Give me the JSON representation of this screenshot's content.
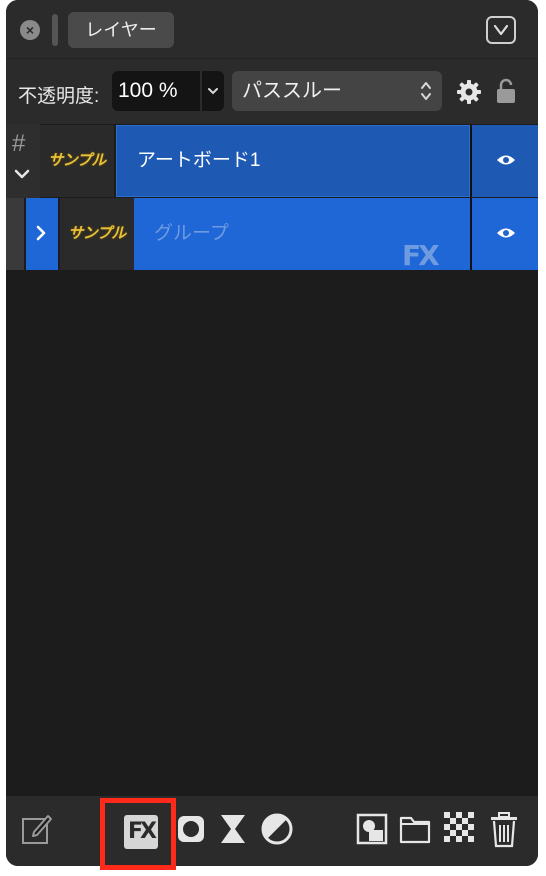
{
  "panel": {
    "tab_label": "レイヤー",
    "icons": {
      "close": "close-icon",
      "collapse": "chevron-down-icon"
    }
  },
  "options": {
    "opacity_label": "不透明度:",
    "opacity_value": "100 %",
    "blend_mode": "パススルー",
    "icons": {
      "settings": "gear-icon",
      "lock": "lock-icon"
    }
  },
  "layers": [
    {
      "name": "アートボード1",
      "thumbnail_text": "サンプル",
      "expanded": true,
      "selected": true,
      "visible": true
    },
    {
      "name": "グループ",
      "thumbnail_text": "サンプル",
      "expanded": false,
      "selected": true,
      "visible": true,
      "has_fx": true,
      "fx_label": "FX"
    }
  ],
  "toolbar": {
    "items": [
      "edit-icon",
      "fx-icon",
      "mask-icon",
      "adjustment-icon",
      "half-circle-icon",
      "image-layer-icon",
      "folder-icon",
      "checkerboard-icon",
      "trash-icon"
    ],
    "fx_label": "FX",
    "highlight_color": "#ff2a1a"
  },
  "colors": {
    "panel_bg": "#1c1c1c",
    "toolbar_bg": "#2b2b2b",
    "selected_row": "#1e5ab4",
    "accent": "#1f66d6"
  }
}
